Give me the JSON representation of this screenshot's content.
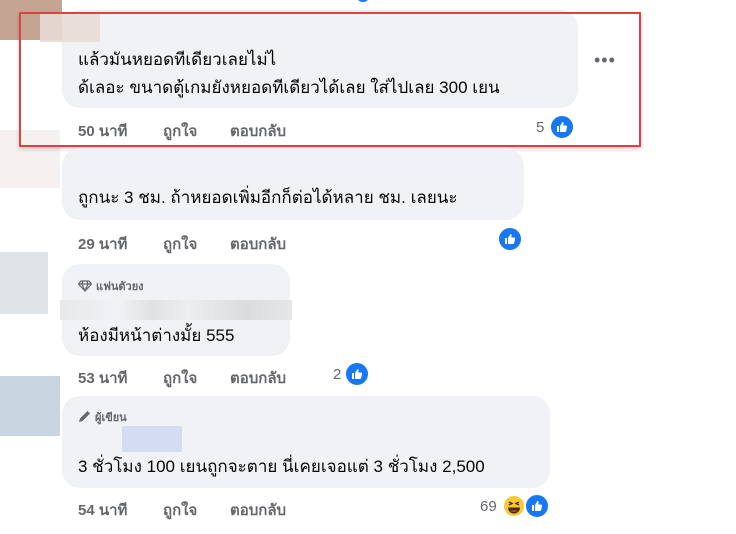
{
  "comments": [
    {
      "text_line1": "แล้วมันหยอดทีเดียวเลยไม่ไ",
      "text_line2": "ด้เลอะ ขนาดตู้เกมยังหยอดทีเดียวได้เลย ใส่ไปเลย 300 เยน",
      "time": "50 นาที",
      "like_label": "ถูกใจ",
      "reply_label": "ตอบกลับ",
      "reaction_count": "5",
      "reaction": "like-icon"
    },
    {
      "text": "ถูกนะ 3 ชม. ถ้าหยอดเพิ่มอีกก็ต่อได้หลาย ชม. เลยนะ",
      "time": "29 นาที",
      "like_label": "ถูกใจ",
      "reply_label": "ตอบกลับ",
      "reaction": "like-icon"
    },
    {
      "badge": "แฟนตัวยง",
      "text": "ห้องมีหน้าต่างมั้ย 555",
      "time": "53 นาที",
      "like_label": "ถูกใจ",
      "reply_label": "ตอบกลับ",
      "reaction_count": "2",
      "reaction": "like-icon"
    },
    {
      "badge": "ผู้เขียน",
      "text": "3 ชั่วโมง 100 เยนถูกจะตาย นี่เคยเจอแต่ 3 ชั่วโมง 2,500",
      "time": "54 นาที",
      "like_label": "ถูกใจ",
      "reply_label": "ตอบกลับ",
      "reaction_count": "69",
      "reaction": "haha-and-like-icons"
    }
  ],
  "colors": {
    "bubble": "#f0f2f5",
    "action_text": "#65676b",
    "like_blue": "#1877f2",
    "highlight_border": "#e0413e"
  }
}
